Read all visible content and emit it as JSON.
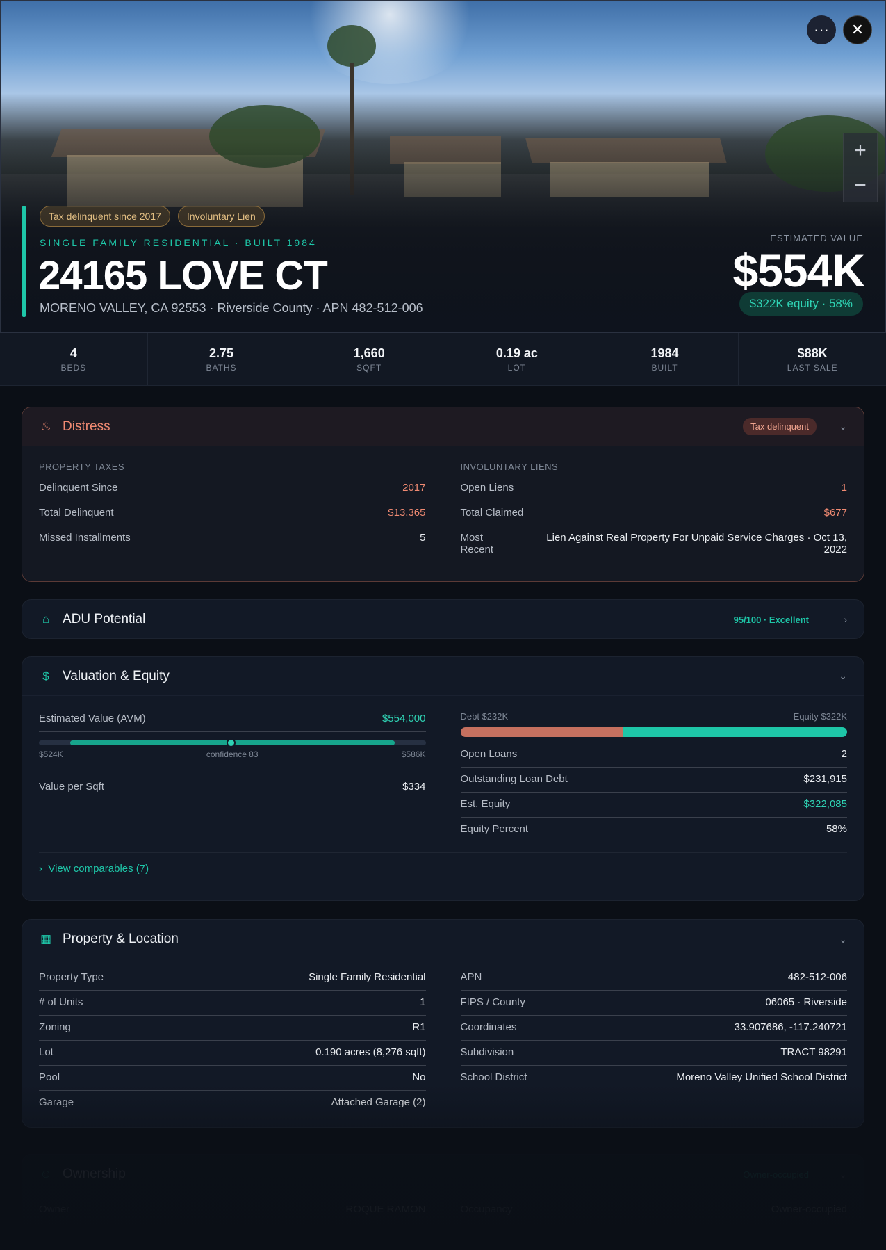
{
  "hero": {
    "badges": [
      "Tax delinquent since 2017",
      "Involuntary Lien"
    ],
    "subtitle": "SINGLE FAMILY RESIDENTIAL · BUILT 1984",
    "title": "24165 LOVE CT",
    "address": "MORENO VALLEY, CA 92553 · Riverside County · APN 482-512-006",
    "estimated_label": "ESTIMATED VALUE",
    "estimated_value": "$554K",
    "equity_badge": "$322K equity · 58%",
    "more_icon": "more-horizontal-icon",
    "close_icon": "close-icon",
    "zoom_in": "+",
    "zoom_out": "−"
  },
  "stats": [
    {
      "value": "4",
      "label": "BEDS"
    },
    {
      "value": "2.75",
      "label": "BATHS"
    },
    {
      "value": "1,660",
      "label": "SQFT"
    },
    {
      "value": "0.19 ac",
      "label": "LOT"
    },
    {
      "value": "1984",
      "label": "BUILT"
    },
    {
      "value": "$88K",
      "label": "LAST SALE"
    }
  ],
  "distress": {
    "title": "Distress",
    "pill": "Tax delinquent",
    "taxes": {
      "heading": "PROPERTY TAXES",
      "rows": [
        {
          "k": "Delinquent Since",
          "v": "2017"
        },
        {
          "k": "Total Delinquent",
          "v": "$13,365"
        },
        {
          "k": "Missed Installments",
          "v": "5"
        }
      ]
    },
    "liens": {
      "heading": "INVOLUNTARY LIENS",
      "rows": [
        {
          "k": "Open Liens",
          "v": "1"
        },
        {
          "k": "Total Claimed",
          "v": "$677"
        },
        {
          "k": "Most Recent",
          "v": "Lien Against Real Property For Unpaid Service Charges · Oct 13, 2022"
        }
      ]
    }
  },
  "adu": {
    "title": "ADU Potential",
    "score": "95/100 · Excellent",
    "score_value": 95
  },
  "valuation": {
    "title": "Valuation & Equity",
    "avm_label": "Estimated Value (AVM)",
    "avm_value": "$554,000",
    "range_low": "$524K",
    "range_high": "$586K",
    "confidence": "confidence 83",
    "per_sqft_label": "Value per Sqft",
    "per_sqft_value": "$334",
    "debt_label": "Debt $232K",
    "equity_label": "Equity $322K",
    "equity_fraction": 0.58,
    "rows": [
      {
        "k": "Open Loans",
        "v": "2"
      },
      {
        "k": "Outstanding Loan Debt",
        "v": "$231,915"
      },
      {
        "k": "Est. Equity",
        "v": "$322,085"
      },
      {
        "k": "Equity Percent",
        "v": "58%"
      }
    ],
    "comparables": "View comparables (7)"
  },
  "property": {
    "title": "Property & Location",
    "left": [
      {
        "k": "Property Type",
        "v": "Single Family Residential"
      },
      {
        "k": "# of Units",
        "v": "1"
      },
      {
        "k": "Zoning",
        "v": "R1"
      },
      {
        "k": "Lot",
        "v": "0.190 acres (8,276 sqft)"
      },
      {
        "k": "Pool",
        "v": "No"
      },
      {
        "k": "Garage",
        "v": "Attached Garage (2)"
      }
    ],
    "right": [
      {
        "k": "APN",
        "v": "482-512-006"
      },
      {
        "k": "FIPS / County",
        "v": "06065 · Riverside"
      },
      {
        "k": "Coordinates",
        "v": "33.907686, -117.240721"
      },
      {
        "k": "Subdivision",
        "v": "TRACT 98291"
      },
      {
        "k": "School District",
        "v": "Moreno Valley Unified School District"
      }
    ]
  },
  "ownership": {
    "title": "Ownership",
    "pill": "Owner-occupied",
    "owner_label": "Owner",
    "owner_value": "ROQUE RAMON",
    "occupancy_label": "Occupancy",
    "occupancy_value": "Owner-occupied"
  }
}
